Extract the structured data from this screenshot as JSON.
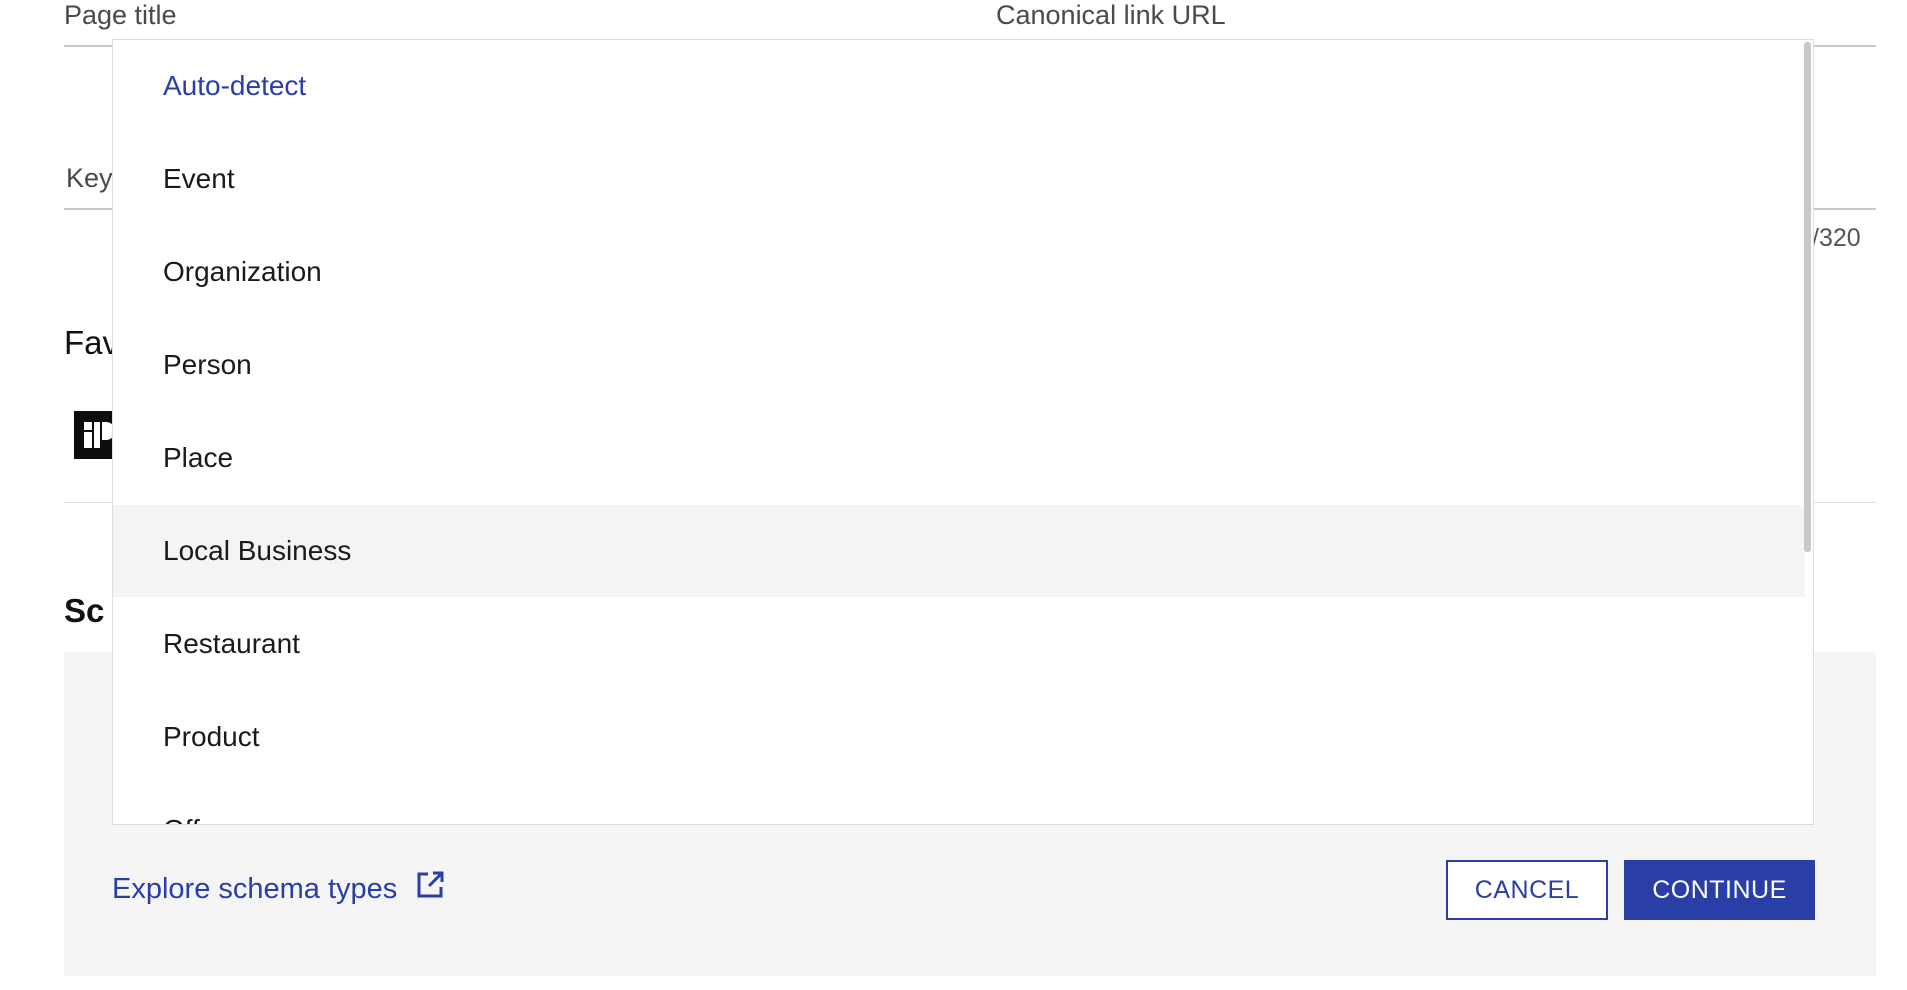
{
  "form": {
    "page_title_label": "Page title",
    "canonical_label": "Canonical link URL",
    "keywords_label_partial": "Key",
    "counter_partial": "/320",
    "favicon_head_partial": "Fav",
    "schema_head_partial": "Sc"
  },
  "dropdown": {
    "options": [
      {
        "label": "Auto-detect",
        "state": "selected"
      },
      {
        "label": "Event",
        "state": "normal"
      },
      {
        "label": "Organization",
        "state": "normal"
      },
      {
        "label": "Person",
        "state": "normal"
      },
      {
        "label": "Place",
        "state": "normal"
      },
      {
        "label": "Local Business",
        "state": "hover"
      },
      {
        "label": "Restaurant",
        "state": "normal"
      },
      {
        "label": "Product",
        "state": "normal"
      },
      {
        "label": "Offer",
        "state": "normal"
      }
    ]
  },
  "footer": {
    "explore_link": "Explore schema types",
    "cancel_label": "CANCEL",
    "continue_label": "CONTINUE"
  },
  "icons": {
    "external_link": "external-link-icon",
    "favicon": "site-logo-icon"
  },
  "colors": {
    "accent": "#2a3ea8",
    "hover_bg": "#f4f4f4",
    "panel_bg": "#f5f5f5"
  }
}
